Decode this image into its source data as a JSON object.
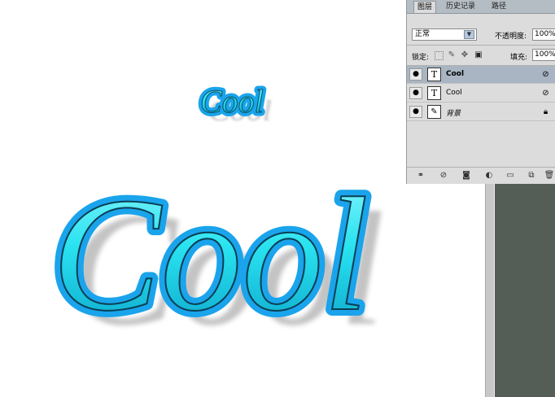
{
  "canvas": {
    "small_text": "Cool",
    "large_text": "Cool"
  },
  "panel": {
    "tabs": [
      {
        "label": "图层"
      },
      {
        "label": "历史记录"
      },
      {
        "label": "路径"
      }
    ],
    "blend_mode": "正常",
    "opacity_label": "不透明度:",
    "opacity_value": "100%",
    "lock_label": "锁定:",
    "fill_label": "填充:",
    "fill_value": "100%",
    "layers": [
      {
        "name": "Cool",
        "kind": "text",
        "selected": true,
        "visible": true,
        "right_icon": "fx-icon"
      },
      {
        "name": "Cool",
        "kind": "text",
        "selected": false,
        "visible": true,
        "right_icon": "fx-icon"
      },
      {
        "name": "背景",
        "kind": "background",
        "selected": false,
        "visible": true,
        "right_icon": "lock-icon"
      }
    ],
    "thumb_text_glyph": "T",
    "bottom_icons": [
      "link-icon",
      "fx-icon",
      "mask-icon",
      "adjustment-icon",
      "folder-icon",
      "new-layer-icon",
      "trash-icon"
    ]
  },
  "colors": {
    "text_fill": "#29e3f0",
    "glow": "#1aa4ec",
    "workspace": "#545e56"
  }
}
